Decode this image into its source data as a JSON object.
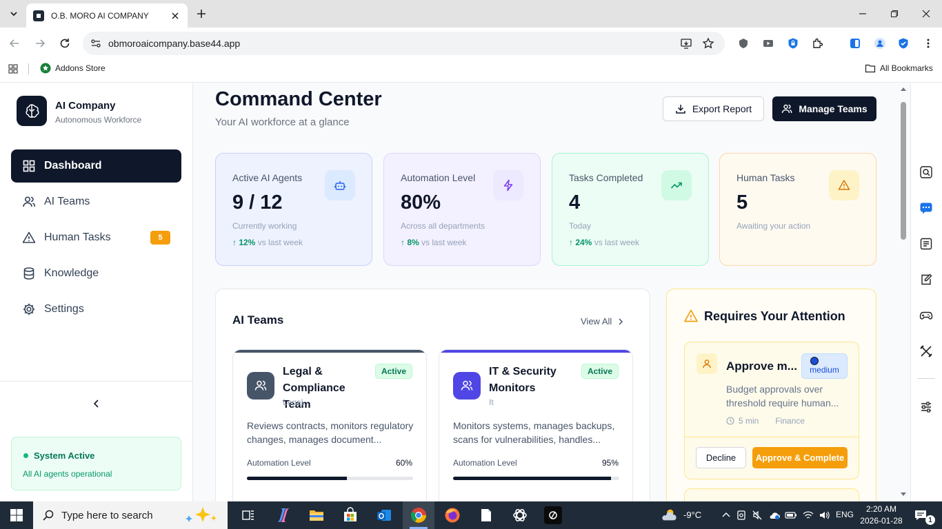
{
  "browser": {
    "tab_title": "O.B. MORO AI COMPANY",
    "url": "obmoroaicompany.base44.app",
    "bookmarks": {
      "addons": "Addons Store",
      "all": "All Bookmarks"
    }
  },
  "sidebar": {
    "brand_title": "AI Company",
    "brand_subtitle": "Autonomous Workforce",
    "items": [
      {
        "label": "Dashboard",
        "icon": "layout-grid-icon",
        "active": true
      },
      {
        "label": "AI Teams",
        "icon": "users-icon"
      },
      {
        "label": "Human Tasks",
        "icon": "alert-triangle-icon",
        "badge": "5"
      },
      {
        "label": "Knowledge",
        "icon": "database-icon"
      },
      {
        "label": "Settings",
        "icon": "gear-icon"
      }
    ],
    "status": {
      "title": "System Active",
      "subtitle": "All AI agents operational"
    }
  },
  "header": {
    "title": "Command Center",
    "subtitle": "Your AI workforce at a glance",
    "export_label": "Export Report",
    "manage_label": "Manage Teams"
  },
  "stats": [
    {
      "label": "Active AI Agents",
      "value": "9 / 12",
      "sub": "Currently working",
      "trend_value": "↑ 12%",
      "trend_text": "vs last week",
      "icon": "bot-icon"
    },
    {
      "label": "Automation Level",
      "value": "80%",
      "sub": "Across all departments",
      "trend_value": "↑ 8%",
      "trend_text": "vs last week",
      "icon": "zap-icon"
    },
    {
      "label": "Tasks Completed",
      "value": "4",
      "sub": "Today",
      "trend_value": "↑ 24%",
      "trend_text": "vs last week",
      "icon": "trending-up-icon"
    },
    {
      "label": "Human Tasks",
      "value": "5",
      "sub": "Awaiting your action",
      "icon": "alert-triangle-icon"
    }
  ],
  "teams": {
    "title": "AI Teams",
    "view_all": "View All",
    "automation_label": "Automation Level",
    "cards": [
      {
        "name": "Legal & Compliance Team",
        "dept": "Legal",
        "status": "Active",
        "desc": "Reviews contracts, monitors regulatory changes, manages document...",
        "pct_label": "60%",
        "level": 0.6
      },
      {
        "name": "IT & Security Monitors",
        "dept": "It",
        "status": "Active",
        "desc": "Monitors systems, manages backups, scans for vulnerabilities, handles...",
        "pct_label": "95%",
        "level": 0.95
      }
    ]
  },
  "attention": {
    "title": "Requires Your Attention",
    "item": {
      "title": "Approve m...",
      "priority": "medium",
      "desc": "Budget approvals over threshold require human...",
      "time": "5 min",
      "dept": "Finance",
      "decline": "Decline",
      "approve": "Approve & Complete"
    }
  },
  "taskbar": {
    "search_placeholder": "Type here to search",
    "temp": "-9°C",
    "lang": "ENG",
    "time": "2:20 AM",
    "date": "2026-01-28",
    "notif_count": "1"
  },
  "colors": {
    "primary": "#0f172a",
    "accent_orange": "#f59e0b",
    "success": "#059669",
    "blue_card": "#eef2ff",
    "purple_card": "#f3f0ff",
    "green_card": "#ecfdf5",
    "orange_card": "#fffbeb"
  }
}
